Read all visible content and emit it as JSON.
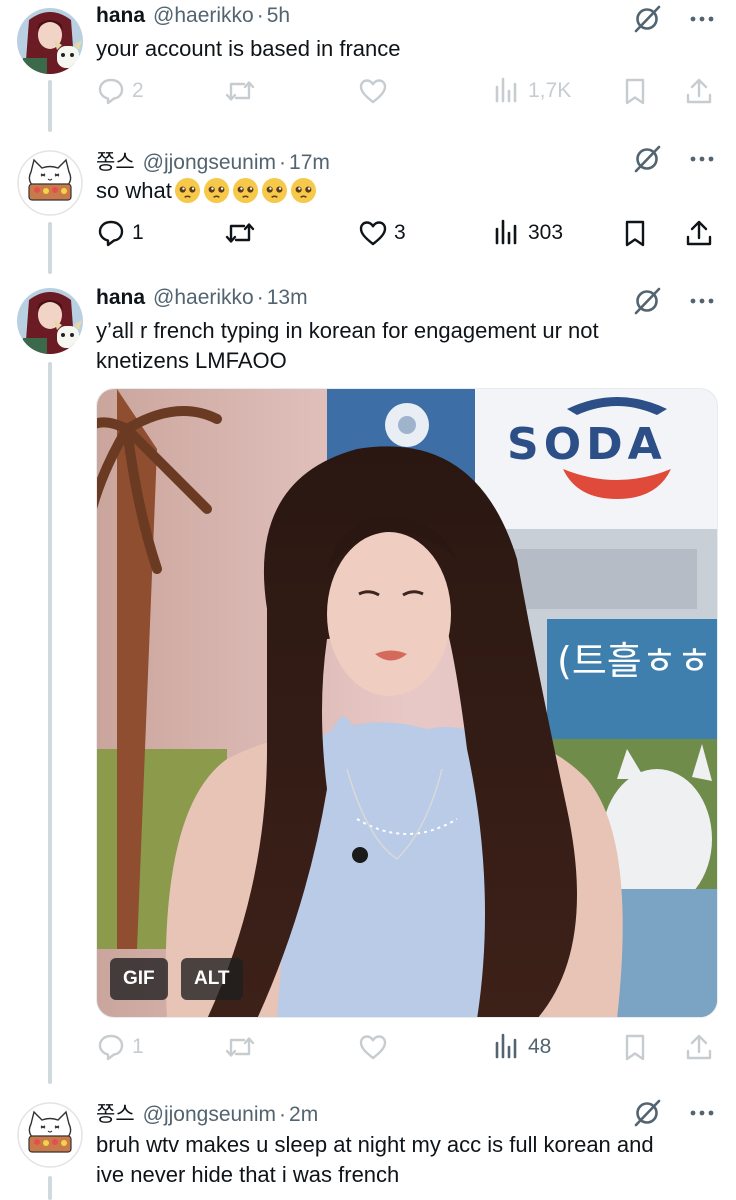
{
  "tweets": [
    {
      "name": "hana",
      "handle": "@haerikko",
      "time": "5h",
      "text": "your account is based in france",
      "replies": "2",
      "retweets": "",
      "likes": "",
      "views": "1,7K",
      "faded": true
    },
    {
      "name": "쫑스",
      "handle": "@jjongseunim",
      "time": "17m",
      "text": "so what",
      "emojis": [
        "pleading-face",
        "pleading-face",
        "pleading-face",
        "pleading-face",
        "pleading-face"
      ],
      "replies": "1",
      "retweets": "",
      "likes": "3",
      "views": "303",
      "faded": false
    },
    {
      "name": "hana",
      "handle": "@haerikko",
      "time": "13m",
      "text_line1": "y’all r french typing in korean for engagement ur not",
      "text_line2": "knetizens LMFAOO",
      "media": {
        "sign_text": "SODA",
        "caption_text": "(트흘ㅎㅎ",
        "gif_badge": "GIF",
        "alt_badge": "ALT"
      },
      "replies": "1",
      "retweets": "",
      "likes": "",
      "views": "48",
      "faded": true
    },
    {
      "name": "쫑스",
      "handle": "@jjongseunim",
      "time": "2m",
      "text_line1": "bruh wtv makes u sleep at night my acc is full korean and",
      "text_line2": "ive never hide that i was french"
    }
  ],
  "separator": "·",
  "icons": [
    "grok-icon",
    "more-icon",
    "reply-icon",
    "retweet-icon",
    "like-icon",
    "views-icon",
    "bookmark-icon",
    "share-icon"
  ],
  "colors": {
    "text": "#0f1419",
    "secondary": "#536471",
    "thread_line": "#cfd9de",
    "emoji_face": "#f6c94a"
  }
}
